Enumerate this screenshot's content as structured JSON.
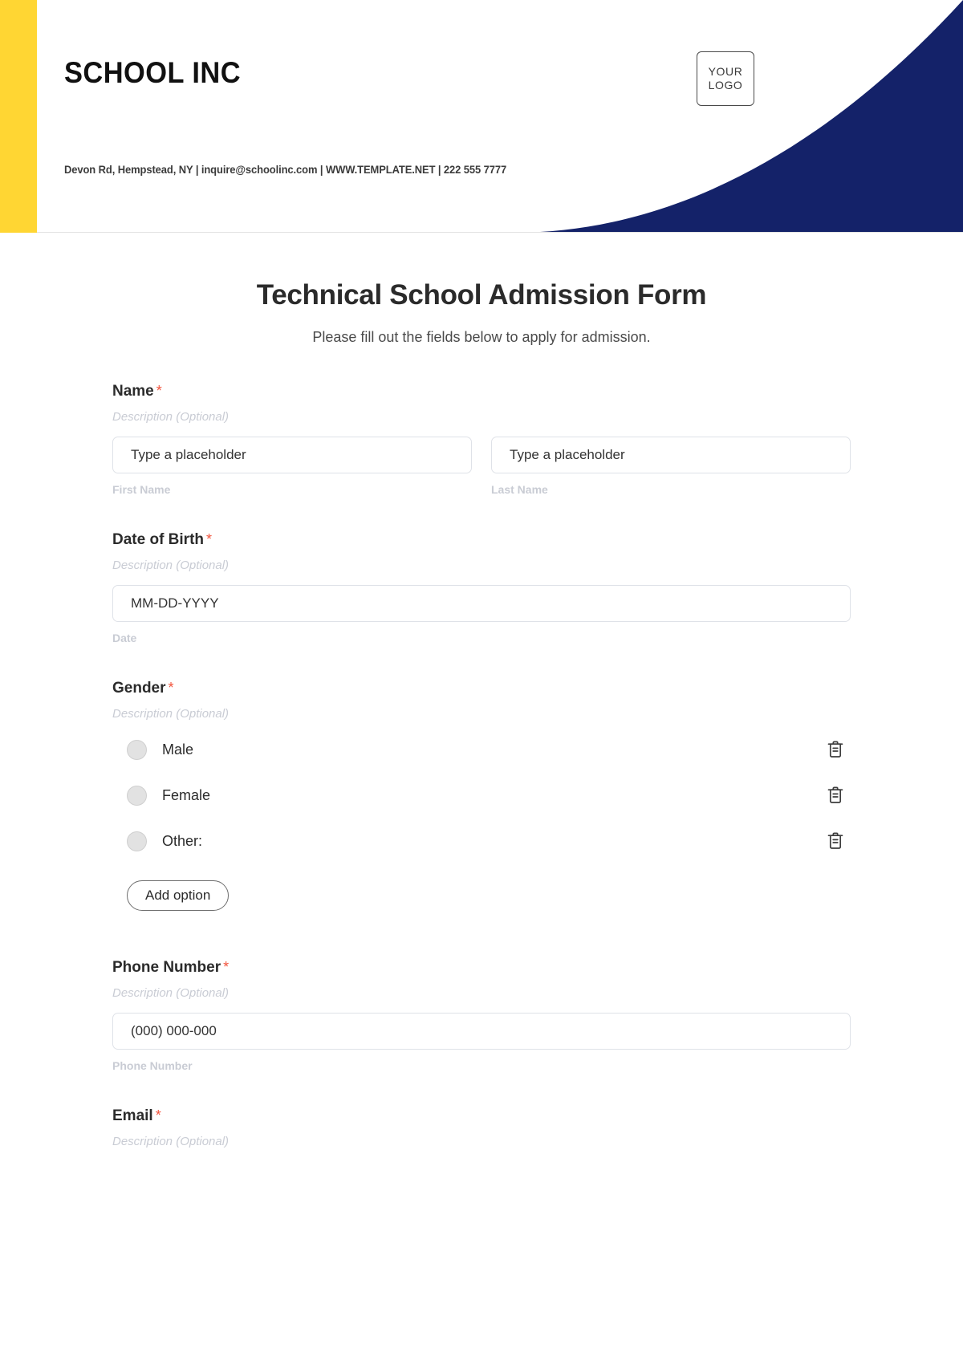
{
  "letterhead": {
    "brand": "SCHOOL INC",
    "contact": "Devon Rd, Hempstead, NY | inquire@schoolinc.com | WWW.TEMPLATE.NET | 222 555 7777",
    "logo_line1": "YOUR",
    "logo_line2": "LOGO",
    "accent_yellow": "#FFD633",
    "accent_navy": "#142269"
  },
  "form": {
    "title": "Technical School Admission Form",
    "subtitle": "Please fill out the fields below to apply for admission.",
    "required_marker": "*",
    "description_placeholder": "Description (Optional)",
    "fields": [
      {
        "label": "Name",
        "description": "Description (Optional)",
        "inputs": [
          {
            "placeholder": "Type a placeholder",
            "value": "",
            "sub_label": "First Name"
          },
          {
            "placeholder": "Type a placeholder",
            "value": "",
            "sub_label": "Last Name"
          }
        ]
      },
      {
        "label": "Date of Birth",
        "description": "Description (Optional)",
        "inputs": [
          {
            "placeholder": "MM-DD-YYYY",
            "value": "",
            "sub_label": "Date"
          }
        ]
      },
      {
        "label": "Gender",
        "description": "Description (Optional)",
        "options": [
          {
            "label": "Male",
            "delete_icon": "trash-icon"
          },
          {
            "label": "Female",
            "delete_icon": "trash-icon"
          },
          {
            "label": "Other:",
            "delete_icon": "trash-icon"
          }
        ],
        "add_option_label": "Add option"
      },
      {
        "label": "Phone Number",
        "description": "Description (Optional)",
        "inputs": [
          {
            "placeholder": "(000) 000-000",
            "value": "",
            "sub_label": "Phone Number"
          }
        ]
      },
      {
        "label": "Email",
        "description": "Description (Optional)",
        "inputs": []
      }
    ]
  }
}
